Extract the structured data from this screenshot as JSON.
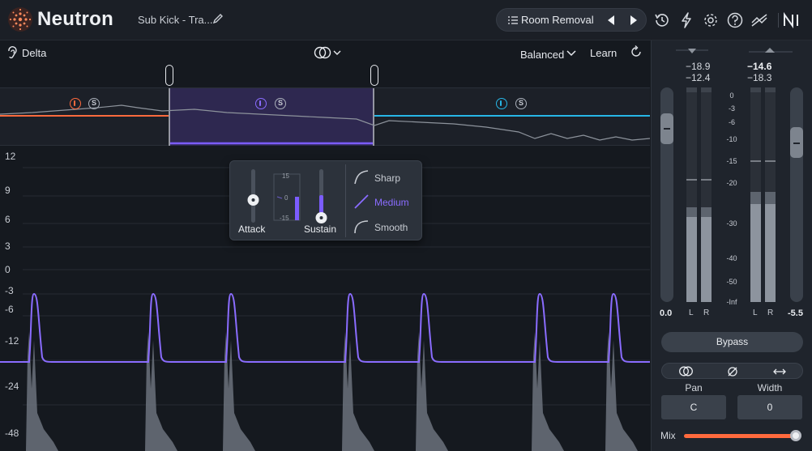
{
  "header": {
    "app_title": "Neutron",
    "track_name": "Sub Kick - Tra...",
    "preset_name": "Room Removal"
  },
  "toolbar": {
    "delta_label": "Delta",
    "mode_label": "Balanced",
    "learn_label": "Learn"
  },
  "bands": [
    {
      "color": "#ff6a3d"
    },
    {
      "color": "#7b5cff"
    },
    {
      "color": "#27b6e6"
    }
  ],
  "graph": {
    "y_ticks": [
      "12",
      "9",
      "6",
      "3",
      "0",
      "-3",
      "-6",
      "-12",
      "-24",
      "-48"
    ],
    "waveform_color": "#8a6cff"
  },
  "popup": {
    "attack_label": "Attack",
    "sustain_label": "Sustain",
    "scale_top": "15",
    "scale_mid": "0",
    "scale_bottom": "-15",
    "curves": {
      "sharp": "Sharp",
      "medium": "Medium",
      "smooth": "Smooth"
    }
  },
  "meters": {
    "input_peak": "−18.9",
    "input_rms": "−12.4",
    "output_peak": "−14.6",
    "output_rms": "−18.3",
    "scale": [
      "0",
      "-3",
      "-6",
      "-10",
      "-15",
      "-20",
      "-30",
      "-40",
      "-50",
      "-Inf"
    ],
    "left_label": "L",
    "right_label": "R",
    "input_gain": "0.0",
    "output_gain": "-5.5"
  },
  "controls": {
    "bypass_label": "Bypass",
    "pan_label": "Pan",
    "pan_value": "C",
    "width_label": "Width",
    "width_value": "0",
    "mix_label": "Mix"
  }
}
